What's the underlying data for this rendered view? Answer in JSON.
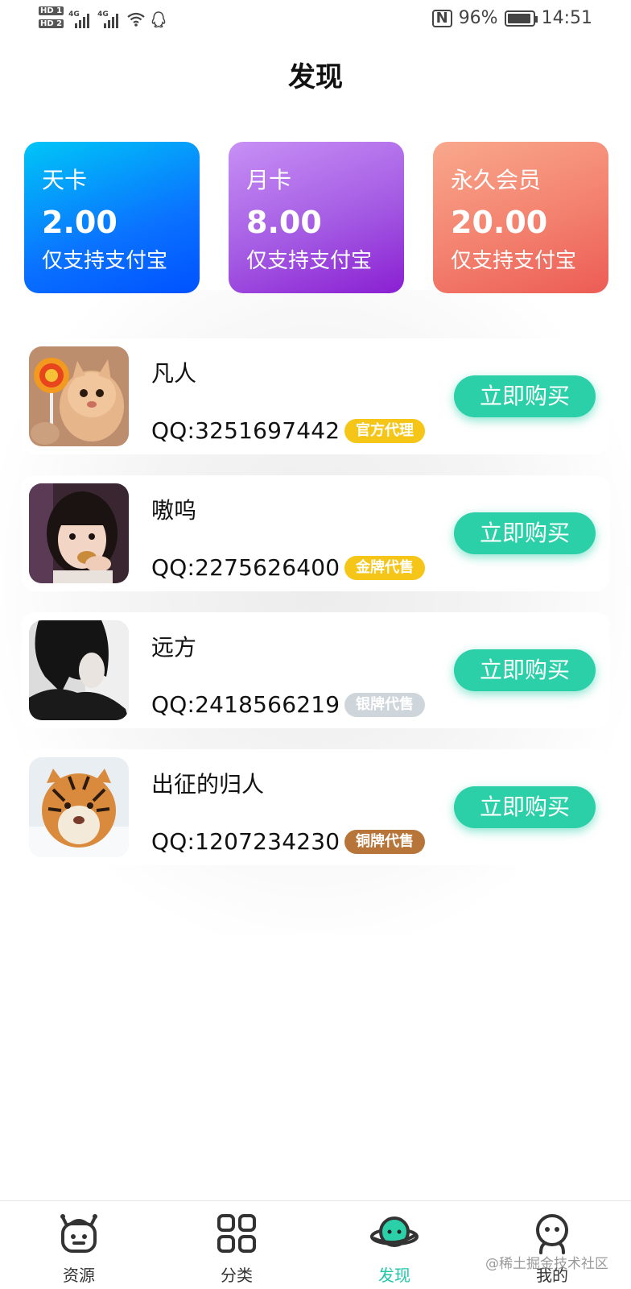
{
  "status_bar": {
    "sim1": "HD 1",
    "sim2": "HD 2",
    "signal1": "4G",
    "signal2": "4G",
    "nfc": "N",
    "battery": "96%",
    "battery_level": 0.96,
    "time": "14:51"
  },
  "header": {
    "title": "发现"
  },
  "plans": [
    {
      "name": "天卡",
      "price": "2.00",
      "note": "仅支持支付宝"
    },
    {
      "name": "月卡",
      "price": "8.00",
      "note": "仅支持支付宝"
    },
    {
      "name": "永久会员",
      "price": "20.00",
      "note": "仅支持支付宝"
    }
  ],
  "agents": [
    {
      "name": "凡人",
      "qq": "QQ:3251697442",
      "badge": "官方代理",
      "badge_color": "#f5c518",
      "button": "立即购买"
    },
    {
      "name": "嗷呜",
      "qq": "QQ:2275626400",
      "badge": "金牌代售",
      "badge_color": "#f5c518",
      "button": "立即购买"
    },
    {
      "name": "远方",
      "qq": "QQ:2418566219",
      "badge": "银牌代售",
      "badge_color": "#cfd6db",
      "button": "立即购买"
    },
    {
      "name": "出征的归人",
      "qq": "QQ:1207234230",
      "badge": "铜牌代售",
      "badge_color": "#b8753a",
      "button": "立即购买"
    }
  ],
  "colors": {
    "accent": "#2bd0a8",
    "nav_active": "#1ec7a7"
  },
  "nav": {
    "items": [
      {
        "label": "资源",
        "icon": "robot-icon"
      },
      {
        "label": "分类",
        "icon": "grid-icon"
      },
      {
        "label": "发现",
        "icon": "planet-icon"
      },
      {
        "label": "我的",
        "icon": "person-icon"
      }
    ],
    "active_index": 2
  },
  "watermark": "@稀土掘金技术社区"
}
